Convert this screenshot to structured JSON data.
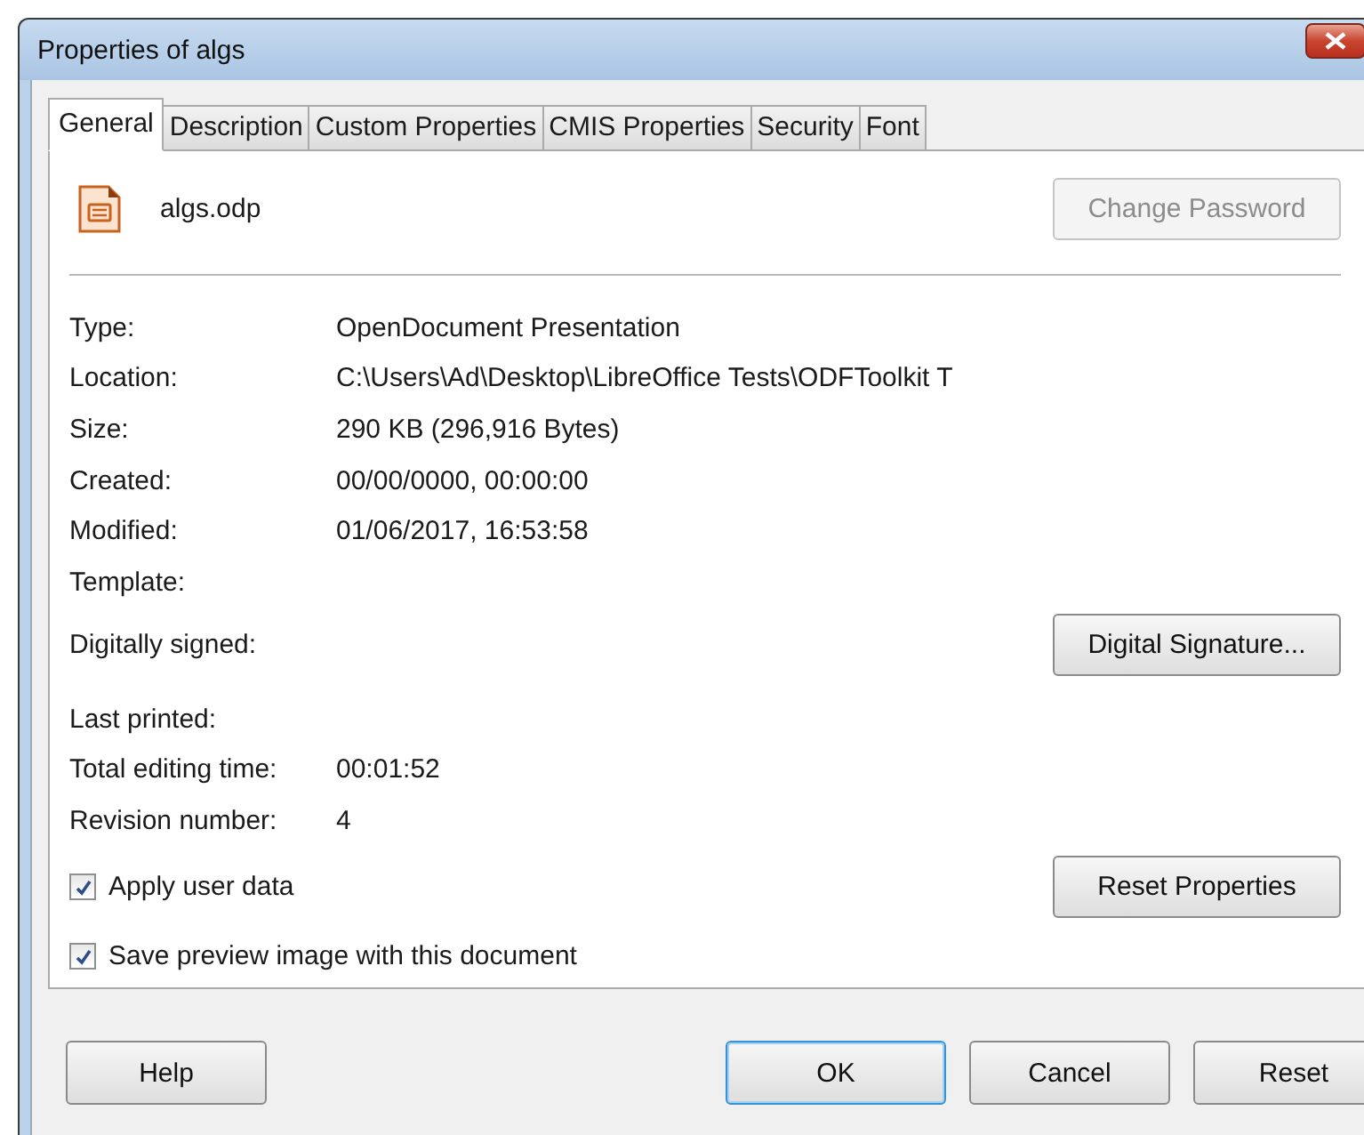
{
  "window": {
    "title": "Properties of algs"
  },
  "tabs": [
    {
      "label": "General",
      "selected": true
    },
    {
      "label": "Description",
      "selected": false
    },
    {
      "label": "Custom Properties",
      "selected": false
    },
    {
      "label": "CMIS Properties",
      "selected": false
    },
    {
      "label": "Security",
      "selected": false
    },
    {
      "label": "Font",
      "selected": false
    }
  ],
  "file": {
    "name": "algs.odp"
  },
  "change_password": {
    "label": "Change Password",
    "disabled": true
  },
  "fields": [
    {
      "label": "Type:",
      "value": "OpenDocument Presentation"
    },
    {
      "label": "Location:",
      "value": "C:\\Users\\Ad\\Desktop\\LibreOffice Tests\\ODFToolkit T"
    },
    {
      "label": "Size:",
      "value": "290 KB (296,916 Bytes)"
    },
    {
      "label": "Created:",
      "value": "00/00/0000, 00:00:00"
    },
    {
      "label": "Modified:",
      "value": "01/06/2017, 16:53:58"
    },
    {
      "label": "Template:"
    }
  ],
  "signature": {
    "label": "Digitally signed:",
    "button": "Digital Signature..."
  },
  "stats": [
    {
      "label": "Last printed:"
    },
    {
      "label": "Total editing time:",
      "value": "00:01:52"
    },
    {
      "label": "Revision number:",
      "value": "4"
    }
  ],
  "options": [
    {
      "label": "Apply user data",
      "checked": true
    },
    {
      "label": "Save preview image with this document",
      "checked": true
    }
  ],
  "reset_properties": {
    "label": "Reset Properties"
  },
  "buttons": [
    {
      "label": "Help",
      "default": false
    },
    {
      "label": "OK",
      "default": true
    },
    {
      "label": "Cancel",
      "default": false
    },
    {
      "label": "Reset",
      "default": false
    }
  ]
}
